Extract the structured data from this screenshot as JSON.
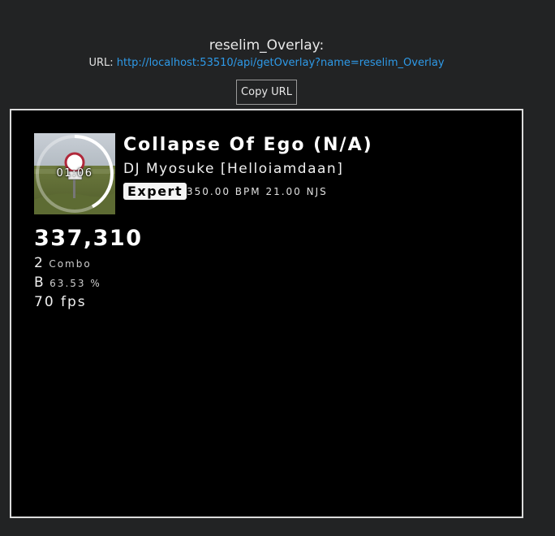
{
  "header": {
    "overlay_name": "reselim_Overlay:",
    "url_label": "URL:",
    "url": "http://localhost:53510/api/getOverlay?name=reselim_Overlay",
    "copy_button_label": "Copy URL"
  },
  "overlay": {
    "timer": "01:06",
    "song_title": "Collapse Of Ego (N/A)",
    "artist_mapper": "DJ Myosuke [Helloiamdaan]",
    "difficulty": "Expert",
    "bpm_njs": "350.00 BPM 21.00 NJS",
    "score": "337,310",
    "combo_value": "2",
    "combo_label": "Combo",
    "rank": "B",
    "accuracy": "63.53 %",
    "fps": "70 fps",
    "song_progress": 0.42
  },
  "colors": {
    "page_background": "#222324",
    "link": "#2e9ae8",
    "preview_background": "#000000",
    "preview_border": "#dcdcdc",
    "difficulty_badge": "#f4f4f4"
  },
  "icons": {
    "cover": "album-cover-image",
    "progress_ring": "song-progress-ring"
  }
}
